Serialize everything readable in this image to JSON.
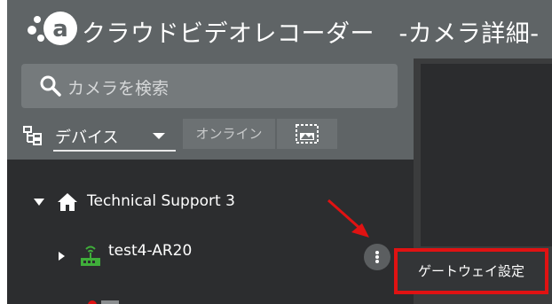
{
  "header": {
    "title": "クラウドビデオレコーダー　-カメラ詳細-",
    "logo_icon": "cloud-logo-icon"
  },
  "search": {
    "placeholder": "カメラを検索",
    "icon": "search-icon"
  },
  "toolbar": {
    "view_icon": "device-tree-icon",
    "view_select_value": "デバイス",
    "online_label": "オンライン",
    "image_icon": "image-frame-icon"
  },
  "tree": {
    "root": {
      "label": "Technical Support 3",
      "icon": "home-icon",
      "expanded": true
    },
    "children": [
      {
        "label": "test4-AR20",
        "icon": "gateway-icon",
        "expanded": false
      }
    ]
  },
  "context_menu": {
    "items": [
      {
        "label": "ゲートウェイ設定"
      }
    ]
  },
  "colors": {
    "header_bg": "#5f6466",
    "tree_bg": "#2c2d2f",
    "highlight_border": "#e01212",
    "gateway_green": "#3fae3a"
  }
}
